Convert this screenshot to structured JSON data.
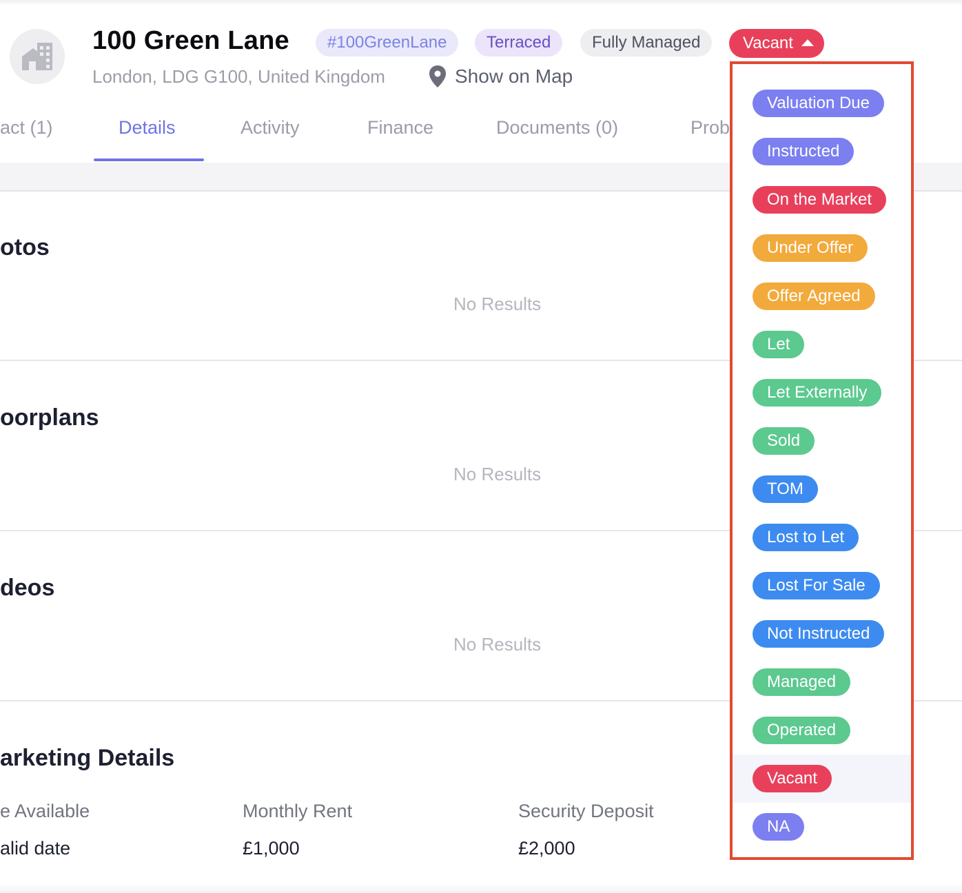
{
  "header": {
    "title": "100 Green Lane",
    "address": "London, LDG G100, United Kingdom",
    "map_link": "Show on Map",
    "tags": [
      "#100GreenLane",
      "Terraced",
      "Fully Managed"
    ],
    "status": "Vacant"
  },
  "tabs": [
    {
      "label": "act (1)"
    },
    {
      "label": "Details",
      "active": true
    },
    {
      "label": "Activity"
    },
    {
      "label": "Finance"
    },
    {
      "label": "Documents (0)"
    },
    {
      "label": "Prob"
    }
  ],
  "sections": [
    {
      "title": "otos",
      "empty_text": "No Results"
    },
    {
      "title": "oorplans",
      "empty_text": "No Results"
    },
    {
      "title": "deos",
      "empty_text": "No Results"
    },
    {
      "title": "arketing Details"
    }
  ],
  "marketing": {
    "fields": [
      {
        "label": "e Available",
        "value": "alid date"
      },
      {
        "label": "Monthly Rent",
        "value": "£1,000"
      },
      {
        "label": "Security Deposit",
        "value": "£2,000"
      }
    ]
  },
  "status_dropdown": {
    "selected": "Vacant",
    "options": [
      {
        "label": "Valuation Due",
        "color": "#7b7ff0"
      },
      {
        "label": "Instructed",
        "color": "#7b7ff0"
      },
      {
        "label": "On the Market",
        "color": "#e8405b"
      },
      {
        "label": "Under Offer",
        "color": "#f2aa3c"
      },
      {
        "label": "Offer Agreed",
        "color": "#f2aa3c"
      },
      {
        "label": "Let",
        "color": "#5cc98f"
      },
      {
        "label": "Let Externally",
        "color": "#5cc98f"
      },
      {
        "label": "Sold",
        "color": "#5cc98f"
      },
      {
        "label": "TOM",
        "color": "#3d8bf0"
      },
      {
        "label": "Lost to Let",
        "color": "#3d8bf0"
      },
      {
        "label": "Lost For Sale",
        "color": "#3d8bf0"
      },
      {
        "label": "Not Instructed",
        "color": "#3d8bf0"
      },
      {
        "label": "Managed",
        "color": "#5cc98f"
      },
      {
        "label": "Operated",
        "color": "#5cc98f"
      },
      {
        "label": "Vacant",
        "color": "#e8405b"
      },
      {
        "label": "NA",
        "color": "#7b7ff0"
      }
    ]
  },
  "colors": {
    "accent": "#6f74e4",
    "status_red": "#e8405b",
    "dropdown_border": "#e04a32"
  }
}
